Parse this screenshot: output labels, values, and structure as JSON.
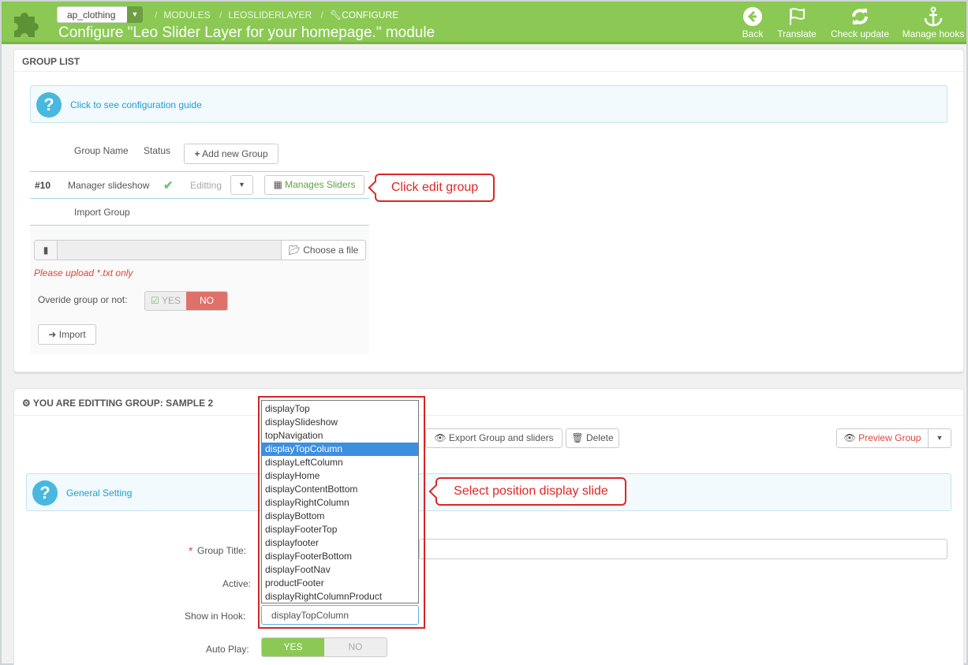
{
  "header": {
    "shop_selector": "ap_clothing",
    "breadcrumb": [
      "MODULES",
      "LEOSLIDERLAYER",
      "CONFIGURE"
    ],
    "title": "Configure \"Leo Slider Layer for your homepage.\" module",
    "toolbar": [
      {
        "label": "Back",
        "icon": "back-arrow-icon"
      },
      {
        "label": "Translate",
        "icon": "flag-icon"
      },
      {
        "label": "Check update",
        "icon": "refresh-icon"
      },
      {
        "label": "Manage hooks",
        "icon": "anchor-icon"
      }
    ]
  },
  "group_list": {
    "heading": "GROUP LIST",
    "guide_link": "Click to see configuration guide",
    "col_group_name": "Group Name",
    "col_status": "Status",
    "add_group_label": "Add new Group",
    "row": {
      "id": "#10",
      "name": "Manager slideshow",
      "edit_label": "Editting",
      "manage_label": "Manages Sliders"
    },
    "import_heading": "Import Group",
    "choose_file_label": "Choose a file",
    "upload_hint": "Please upload *.txt only",
    "override_label": "Overide group or not:",
    "override_yes": "YES",
    "override_no": "NO",
    "import_label": "Import"
  },
  "callouts": {
    "edit_group": "Click edit group",
    "select_position": "Select position display slide"
  },
  "edit_group": {
    "heading": "YOU ARE EDITTING GROUP: SAMPLE 2",
    "export_label": "Export Group and sliders",
    "delete_label": "Delete",
    "preview_label": "Preview Group",
    "general_setting": "General Setting",
    "required_mark": "*",
    "group_title_label": "Group Title:",
    "active_label": "Active:",
    "show_in_hook_label": "Show in Hook:",
    "show_in_hook_value": "displayTopColumn",
    "autoplay_label": "Auto Play:",
    "autoplay_yes": "YES",
    "autoplay_no": "NO"
  },
  "hook_options": [
    "displayTop",
    "displaySlideshow",
    "topNavigation",
    "displayTopColumn",
    "displayLeftColumn",
    "displayHome",
    "displayContentBottom",
    "displayRightColumn",
    "displayBottom",
    "displayFooterTop",
    "displayfooter",
    "displayFooterBottom",
    "displayFootNav",
    "productFooter",
    "displayRightColumnProduct"
  ],
  "hook_selected_index": 3,
  "colors": {
    "header_green": "#8bc954",
    "accent_blue": "#1d9ed1",
    "danger_red": "#e02525",
    "yes_green": "#8bc954",
    "no_red": "#e0716a"
  }
}
